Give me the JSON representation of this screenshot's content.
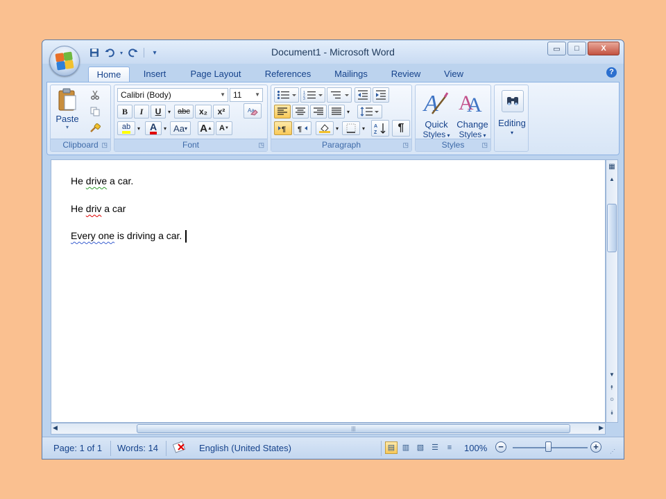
{
  "window": {
    "title": "Document1 - Microsoft Word"
  },
  "quick_access": {
    "icons": [
      "save-icon",
      "undo-icon",
      "redo-icon",
      "customize-icon"
    ]
  },
  "window_controls": {
    "minimize": "▭",
    "maximize": "□",
    "close": "X"
  },
  "tabs": [
    {
      "label": "Home",
      "active": true
    },
    {
      "label": "Insert"
    },
    {
      "label": "Page Layout"
    },
    {
      "label": "References"
    },
    {
      "label": "Mailings"
    },
    {
      "label": "Review"
    },
    {
      "label": "View"
    }
  ],
  "help": "?",
  "ribbon": {
    "clipboard": {
      "label": "Clipboard",
      "paste": "Paste"
    },
    "font": {
      "label": "Font",
      "font_name": "Calibri (Body)",
      "font_size": "11",
      "bold": "B",
      "italic": "I",
      "underline": "U",
      "strike": "abc",
      "subscript": "x₂",
      "superscript": "x²",
      "highlight": "ab",
      "font_color": "A",
      "change_case": "Aa",
      "grow": "A",
      "shrink": "A"
    },
    "paragraph": {
      "label": "Paragraph"
    },
    "styles": {
      "label": "Styles",
      "quick_styles_1": "Quick",
      "quick_styles_2": "Styles",
      "change_styles_1": "Change",
      "change_styles_2": "Styles"
    },
    "editing": {
      "label": "Editing"
    }
  },
  "document": {
    "paragraphs": [
      {
        "pre": "He ",
        "marked": "drive",
        "post": " a car.",
        "mark": "green"
      },
      {
        "pre": "He ",
        "marked": "driv",
        "post": " a car",
        "mark": "red"
      },
      {
        "pre": "",
        "marked": "Every one",
        "post": " is driving a car.",
        "mark": "blue"
      }
    ]
  },
  "status": {
    "page": "Page: 1 of 1",
    "words": "Words: 14",
    "language": "English (United States)",
    "zoom": "100%",
    "zoom_minus": "−",
    "zoom_plus": "+",
    "zoom_value": 100,
    "active_view": "print-layout"
  },
  "colors": {
    "background": "#fac090",
    "ribbon_text": "#15428b",
    "spelling_error": "#e00000",
    "grammar_error": "#2a9a2a"
  }
}
